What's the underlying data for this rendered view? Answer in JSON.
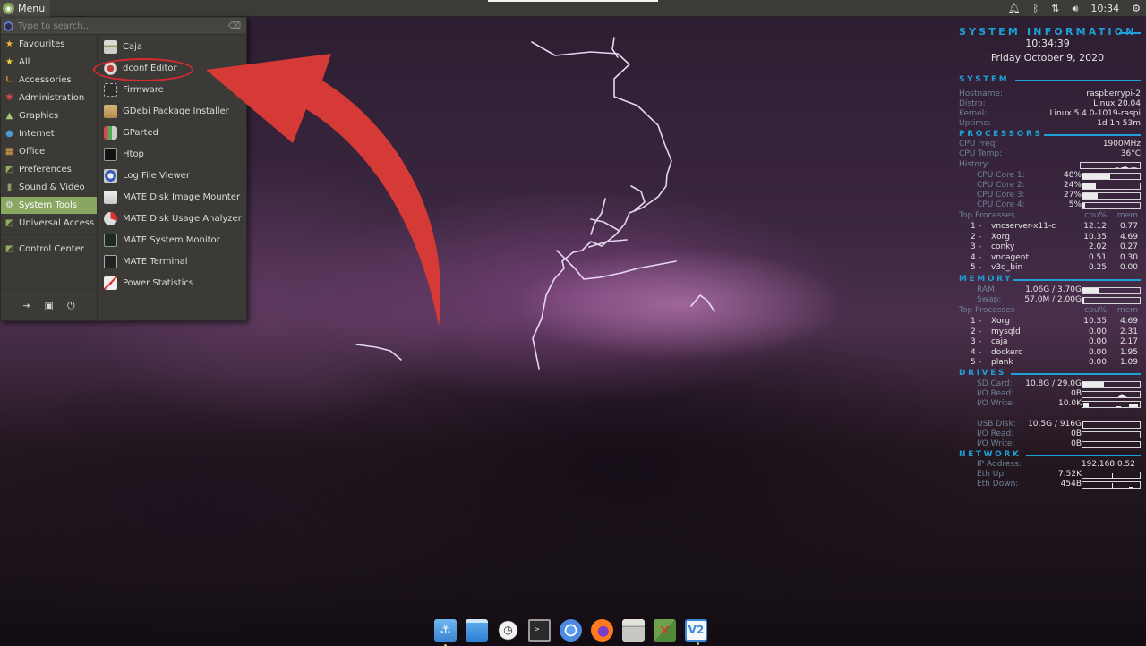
{
  "top_panel": {
    "menu_label": "Menu",
    "clock": "10:34",
    "tray_icons": [
      "notification-bell-icon",
      "bluetooth-icon",
      "network-arrows-icon",
      "volume-icon"
    ],
    "settings_icon": "gear-icon"
  },
  "menu": {
    "search_placeholder": "Type to search...",
    "categories": [
      {
        "label": "Favourites",
        "icon": "star-icon"
      },
      {
        "label": "All",
        "icon": "star-icon"
      },
      {
        "label": "Accessories",
        "icon": "accessories-icon"
      },
      {
        "label": "Administration",
        "icon": "administration-icon"
      },
      {
        "label": "Graphics",
        "icon": "graphics-icon"
      },
      {
        "label": "Internet",
        "icon": "globe-icon"
      },
      {
        "label": "Office",
        "icon": "office-icon"
      },
      {
        "label": "Preferences",
        "icon": "preferences-icon"
      },
      {
        "label": "Sound & Video",
        "icon": "sound-video-icon"
      },
      {
        "label": "System Tools",
        "icon": "gear-icon",
        "active": true
      },
      {
        "label": "Universal Access",
        "icon": "preferences-icon"
      }
    ],
    "control_center": "Control Center",
    "footer_buttons": [
      "logout-icon",
      "lock-screen-icon",
      "power-icon"
    ],
    "apps": [
      {
        "label": "Caja",
        "icon": "file-manager-icon"
      },
      {
        "label": "dconf Editor",
        "icon": "dconf-icon",
        "highlighted": true
      },
      {
        "label": "Firmware",
        "icon": "firmware-icon"
      },
      {
        "label": "GDebi Package Installer",
        "icon": "package-icon"
      },
      {
        "label": "GParted",
        "icon": "gparted-icon"
      },
      {
        "label": "Htop",
        "icon": "htop-icon"
      },
      {
        "label": "Log File Viewer",
        "icon": "log-viewer-icon"
      },
      {
        "label": "MATE Disk Image Mounter",
        "icon": "disk-image-icon"
      },
      {
        "label": "MATE Disk Usage Analyzer",
        "icon": "disk-usage-icon"
      },
      {
        "label": "MATE System Monitor",
        "icon": "system-monitor-icon"
      },
      {
        "label": "MATE Terminal",
        "icon": "terminal-icon"
      },
      {
        "label": "Power Statistics",
        "icon": "power-statistics-icon"
      }
    ]
  },
  "annotation": {
    "color": "#d63a36",
    "target": "dconf Editor"
  },
  "conky": {
    "title": "SYSTEM INFORMATION",
    "time": "10:34:39",
    "date": "Friday October  9, 2020",
    "system": {
      "heading": "SYSTEM",
      "rows": [
        {
          "label": "Hostname:",
          "value": "raspberrypi-2"
        },
        {
          "label": "Distro:",
          "value": "Linux 20.04"
        },
        {
          "label": "Kernel:",
          "value": "Linux 5.4.0-1019-raspi"
        },
        {
          "label": "Uptime:",
          "value": "1d 1h 53m"
        }
      ]
    },
    "processors": {
      "heading": "PROCESSORS",
      "freq_label": "CPU Freq:",
      "freq": "1900MHz",
      "temp_label": "CPU Temp:",
      "temp": "36°C",
      "history_label": "History:",
      "cores": [
        {
          "label": "CPU Core 1:",
          "value": "48%",
          "percent": 48
        },
        {
          "label": "CPU Core 2:",
          "value": "24%",
          "percent": 24
        },
        {
          "label": "CPU Core 3:",
          "value": "27%",
          "percent": 27
        },
        {
          "label": "CPU Core 4:",
          "value": "5%",
          "percent": 5
        }
      ],
      "top_label": "Top Processes",
      "col_cpu": "cpu%",
      "col_mem": "mem",
      "top": [
        {
          "rank": "1",
          "name": "vncserver-x11-c",
          "cpu": "12.12",
          "mem": "0.77"
        },
        {
          "rank": "2",
          "name": "Xorg",
          "cpu": "10.35",
          "mem": "4.69"
        },
        {
          "rank": "3",
          "name": "conky",
          "cpu": "2.02",
          "mem": "0.27"
        },
        {
          "rank": "4",
          "name": "vncagent",
          "cpu": "0.51",
          "mem": "0.30"
        },
        {
          "rank": "5",
          "name": "v3d_bin",
          "cpu": "0.25",
          "mem": "0.00"
        }
      ]
    },
    "memory": {
      "heading": "MEMORY",
      "ram_label": "RAM:",
      "ram": "1.06G / 3.70G",
      "ram_percent": 29,
      "swap_label": "Swap:",
      "swap": "57.0M / 2.00G",
      "swap_percent": 3,
      "top_label": "Top Processes",
      "col_cpu": "cpu%",
      "col_mem": "mem",
      "top": [
        {
          "rank": "1",
          "name": "Xorg",
          "cpu": "10.35",
          "mem": "4.69"
        },
        {
          "rank": "2",
          "name": "mysqld",
          "cpu": "0.00",
          "mem": "2.31"
        },
        {
          "rank": "3",
          "name": "caja",
          "cpu": "0.00",
          "mem": "2.17"
        },
        {
          "rank": "4",
          "name": "dockerd",
          "cpu": "0.00",
          "mem": "1.95"
        },
        {
          "rank": "5",
          "name": "plank",
          "cpu": "0.00",
          "mem": "1.09"
        }
      ]
    },
    "drives": {
      "heading": "DRIVES",
      "sd_label": "SD Card:",
      "sd": "10.8G / 29.0G",
      "sd_percent": 37,
      "sd_read_label": "I/O Read:",
      "sd_read": "0B",
      "sd_write_label": "I/O Write:",
      "sd_write": "10.0K",
      "usb_label": "USB Disk:",
      "usb": "10.5G / 916G",
      "usb_percent": 1,
      "usb_read_label": "I/O Read:",
      "usb_read": "0B",
      "usb_write_label": "I/O Write:",
      "usb_write": "0B"
    },
    "network": {
      "heading": "NETWORK",
      "ip_label": "IP Address:",
      "ip": "192.168.0.52",
      "up_label": "Eth Up:",
      "up": "7.52K",
      "down_label": "Eth Down:",
      "down": "454B"
    }
  },
  "dock": [
    {
      "name": "anchor-app-icon",
      "active": true
    },
    {
      "name": "desktop-window-icon"
    },
    {
      "name": "clock-app-icon"
    },
    {
      "name": "terminal-app-icon"
    },
    {
      "name": "chromium-icon"
    },
    {
      "name": "firefox-icon"
    },
    {
      "name": "file-manager-icon"
    },
    {
      "name": "system-tools-icon"
    },
    {
      "name": "vnc-viewer-icon",
      "active": true
    }
  ]
}
